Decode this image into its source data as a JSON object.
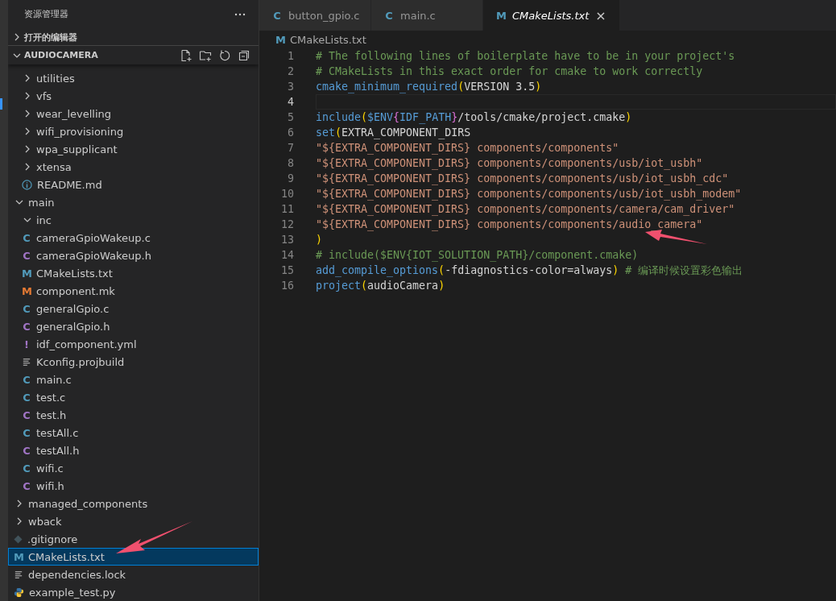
{
  "explorer": {
    "title": "资源管理器",
    "open_editors": {
      "label": "打开的编辑器",
      "expanded": false
    },
    "project": {
      "label": "AUDIOCAMERA",
      "expanded": true,
      "children": [
        {
          "kind": "continued",
          "children": [
            {
              "kind": "folder",
              "label": "utilities",
              "expanded": false,
              "selected": false
            },
            {
              "kind": "folder",
              "label": "vfs",
              "expanded": false,
              "selected": false
            },
            {
              "kind": "folder",
              "label": "wear_levelling",
              "expanded": false,
              "selected": false
            },
            {
              "kind": "folder",
              "label": "wifi_provisioning",
              "expanded": false,
              "selected": false
            },
            {
              "kind": "folder",
              "label": "wpa_supplicant",
              "expanded": false,
              "selected": false
            },
            {
              "kind": "folder",
              "label": "xtensa",
              "expanded": false,
              "selected": false
            },
            {
              "kind": "info-file",
              "label": "README.md",
              "selected": false
            }
          ]
        },
        {
          "kind": "folder",
          "label": "main",
          "expanded": true,
          "selected": false,
          "children": [
            {
              "kind": "folder",
              "label": "inc",
              "expanded": true,
              "selected": false
            },
            {
              "kind": "glyph-file",
              "icon": "C",
              "color": "#519aba",
              "label": "cameraGpioWakeup.c",
              "selected": false
            },
            {
              "kind": "glyph-file",
              "icon": "C",
              "color": "#a074c4",
              "label": "cameraGpioWakeup.h",
              "selected": false
            },
            {
              "kind": "glyph-file",
              "icon": "M",
              "color": "#519aba",
              "label": "CMakeLists.txt",
              "selected": false
            },
            {
              "kind": "glyph-file",
              "icon": "M",
              "color": "#e37933",
              "label": "component.mk",
              "selected": false
            },
            {
              "kind": "glyph-file",
              "icon": "C",
              "color": "#519aba",
              "label": "generalGpio.c",
              "selected": false
            },
            {
              "kind": "glyph-file",
              "icon": "C",
              "color": "#a074c4",
              "label": "generalGpio.h",
              "selected": false
            },
            {
              "kind": "glyph-file",
              "icon": "!",
              "color": "#a074c4",
              "label": "idf_component.yml",
              "selected": false
            },
            {
              "kind": "lines-file",
              "label": "Kconfig.projbuild",
              "selected": false
            },
            {
              "kind": "glyph-file",
              "icon": "C",
              "color": "#519aba",
              "label": "main.c",
              "selected": false
            },
            {
              "kind": "glyph-file",
              "icon": "C",
              "color": "#519aba",
              "label": "test.c",
              "selected": false
            },
            {
              "kind": "glyph-file",
              "icon": "C",
              "color": "#a074c4",
              "label": "test.h",
              "selected": false
            },
            {
              "kind": "glyph-file",
              "icon": "C",
              "color": "#519aba",
              "label": "testAll.c",
              "selected": false
            },
            {
              "kind": "glyph-file",
              "icon": "C",
              "color": "#a074c4",
              "label": "testAll.h",
              "selected": false
            },
            {
              "kind": "glyph-file",
              "icon": "C",
              "color": "#519aba",
              "label": "wifi.c",
              "selected": false
            },
            {
              "kind": "glyph-file",
              "icon": "C",
              "color": "#a074c4",
              "label": "wifi.h",
              "selected": false
            }
          ]
        },
        {
          "kind": "folder",
          "label": "managed_components",
          "expanded": false,
          "selected": false
        },
        {
          "kind": "folder",
          "label": "wback",
          "expanded": false,
          "selected": false
        },
        {
          "kind": "git-file",
          "label": ".gitignore",
          "selected": false
        },
        {
          "kind": "glyph-file",
          "icon": "M",
          "color": "#519aba",
          "label": "CMakeLists.txt",
          "selected": true
        },
        {
          "kind": "lines-file",
          "label": "dependencies.lock",
          "selected": false
        },
        {
          "kind": "python-file",
          "label": "example_test.py",
          "selected": false
        }
      ]
    }
  },
  "tabs": [
    {
      "icon": "C",
      "color": "#519aba",
      "label": "button_gpio.c",
      "selected": false
    },
    {
      "icon": "C",
      "color": "#519aba",
      "label": "main.c",
      "selected": false
    },
    {
      "icon": "M",
      "color": "#519aba",
      "label": "CMakeLists.txt",
      "selected": true,
      "close": "×"
    }
  ],
  "breadcrumb": {
    "icon": "M",
    "color": "#519aba",
    "label": "CMakeLists.txt"
  },
  "code_lines": [
    {
      "number": "1",
      "current": false,
      "tokens": [
        {
          "kind": "comment",
          "text": "# The following lines of boilerplate have to be in your project's"
        }
      ]
    },
    {
      "number": "2",
      "current": false,
      "tokens": [
        {
          "kind": "comment",
          "text": "# CMakeLists in this exact order for cmake to work correctly"
        }
      ]
    },
    {
      "number": "3",
      "current": false,
      "tokens": [
        {
          "kind": "keyword",
          "text": "cmake_minimum_required"
        },
        {
          "kind": "paren",
          "text": "("
        },
        {
          "kind": "plain",
          "text": "VERSION 3.5"
        },
        {
          "kind": "paren",
          "text": ")"
        }
      ]
    },
    {
      "number": "4",
      "current": true
    },
    {
      "number": "5",
      "current": false,
      "tokens": [
        {
          "kind": "keyword",
          "text": "include"
        },
        {
          "kind": "paren",
          "text": "("
        },
        {
          "kind": "keyword",
          "text": "$ENV"
        },
        {
          "kind": "brace",
          "text": "{"
        },
        {
          "kind": "keyword",
          "text": "IDF_PATH"
        },
        {
          "kind": "brace",
          "text": "}"
        },
        {
          "kind": "plain",
          "text": "/tools/cmake/project.cmake"
        },
        {
          "kind": "paren",
          "text": ")"
        }
      ]
    },
    {
      "number": "6",
      "current": false,
      "tokens": [
        {
          "kind": "keyword",
          "text": "set"
        },
        {
          "kind": "paren",
          "text": "("
        },
        {
          "kind": "plain",
          "text": "EXTRA_COMPONENT_DIRS"
        }
      ]
    },
    {
      "number": "7",
      "current": false,
      "tokens": [
        {
          "kind": "string",
          "text": "\"${EXTRA_COMPONENT_DIRS} components/components\""
        }
      ]
    },
    {
      "number": "8",
      "current": false,
      "tokens": [
        {
          "kind": "string",
          "text": "\"${EXTRA_COMPONENT_DIRS} components/components/usb/iot_usbh\""
        }
      ]
    },
    {
      "number": "9",
      "current": false,
      "tokens": [
        {
          "kind": "string",
          "text": "\"${EXTRA_COMPONENT_DIRS} components/components/usb/iot_usbh_cdc\""
        }
      ]
    },
    {
      "number": "10",
      "current": false,
      "tokens": [
        {
          "kind": "string",
          "text": "\"${EXTRA_COMPONENT_DIRS} components/components/usb/iot_usbh_modem\""
        }
      ]
    },
    {
      "number": "11",
      "current": false,
      "tokens": [
        {
          "kind": "string",
          "text": "\"${EXTRA_COMPONENT_DIRS} components/components/camera/cam_driver\""
        }
      ]
    },
    {
      "number": "12",
      "current": false,
      "tokens": [
        {
          "kind": "string",
          "text": "\"${EXTRA_COMPONENT_DIRS} components/components/audio_camera\""
        }
      ]
    },
    {
      "number": "13",
      "current": false,
      "tokens": [
        {
          "kind": "paren",
          "text": ")"
        }
      ]
    },
    {
      "number": "14",
      "current": false,
      "tokens": [
        {
          "kind": "comment",
          "text": "# include($ENV{IOT_SOLUTION_PATH}/component.cmake)"
        }
      ]
    },
    {
      "number": "15",
      "current": false,
      "tokens": [
        {
          "kind": "keyword",
          "text": "add_compile_options"
        },
        {
          "kind": "paren",
          "text": "("
        },
        {
          "kind": "plain",
          "text": "-fdiagnostics-color=always"
        },
        {
          "kind": "paren",
          "text": ")"
        },
        {
          "kind": "comment",
          "text": " # 编译时候设置彩色输出"
        }
      ]
    },
    {
      "number": "16",
      "current": false,
      "tokens": [
        {
          "kind": "keyword",
          "text": "project"
        },
        {
          "kind": "paren",
          "text": "("
        },
        {
          "kind": "plain",
          "text": "audioCamera"
        },
        {
          "kind": "paren",
          "text": ")"
        }
      ]
    }
  ]
}
